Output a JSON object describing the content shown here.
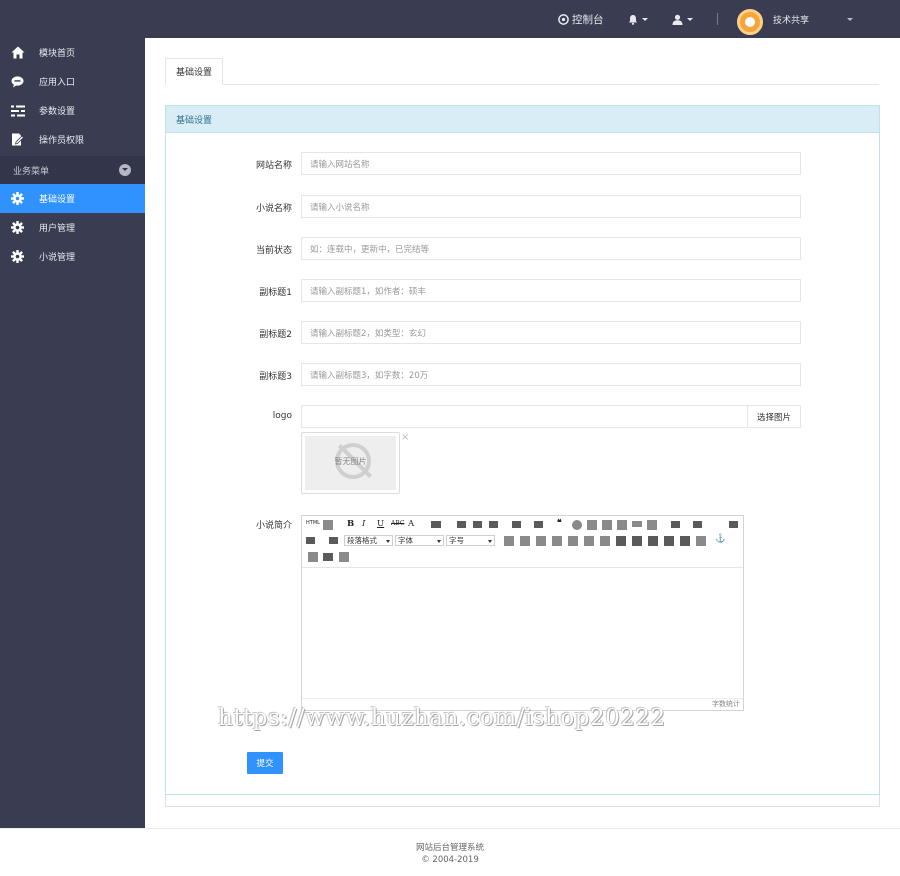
{
  "topbar": {
    "console_label": "控制台",
    "username": "技术共享",
    "icons": [
      "dashboard-icon",
      "bell-icon",
      "user-icon",
      "chevron-down-icon"
    ]
  },
  "sidebar": {
    "items": [
      {
        "label": "模块首页",
        "icon": "home-icon"
      },
      {
        "label": "应用入口",
        "icon": "chat-bubble-icon"
      },
      {
        "label": "参数设置",
        "icon": "sliders-icon"
      },
      {
        "label": "操作员权限",
        "icon": "edit-doc-icon"
      }
    ],
    "group_label": "业务菜单",
    "group_items": [
      {
        "label": "基础设置",
        "icon": "gear-icon",
        "active": true
      },
      {
        "label": "用户管理",
        "icon": "gear-icon",
        "active": false
      },
      {
        "label": "小说管理",
        "icon": "gear-icon",
        "active": false
      }
    ]
  },
  "main": {
    "tab_label": "基础设置",
    "panel_title": "基础设置",
    "form": {
      "site_name": {
        "label": "网站名称",
        "placeholder": "请输入网站名称"
      },
      "novel_name": {
        "label": "小说名称",
        "placeholder": "请输入小说名称"
      },
      "status": {
        "label": "当前状态",
        "placeholder": "如：连载中，更新中，已完结等"
      },
      "subtitle1": {
        "label": "副标题1",
        "placeholder": "请输入副标题1，如作者：硕丰"
      },
      "subtitle2": {
        "label": "副标题2",
        "placeholder": "请输入副标题2，如类型：玄幻"
      },
      "subtitle3": {
        "label": "副标题3",
        "placeholder": "请输入副标题3，如字数：20万"
      },
      "logo": {
        "label": "logo",
        "value": "",
        "button": "选择图片",
        "no_image_text": "暂无图片",
        "remove": "×"
      },
      "intro": {
        "label": "小说简介"
      }
    },
    "editor": {
      "html_btn": "HTML",
      "paragraph_select": "段落格式",
      "font_select": "字体",
      "size_select": "字号",
      "word_count_label": "字数统计"
    },
    "submit_label": "提交"
  },
  "watermark": "https://www.huzhan.com/ishop20222",
  "footer": {
    "system_name": "网站后台管理系统",
    "copyright": "© 2004-2019"
  }
}
